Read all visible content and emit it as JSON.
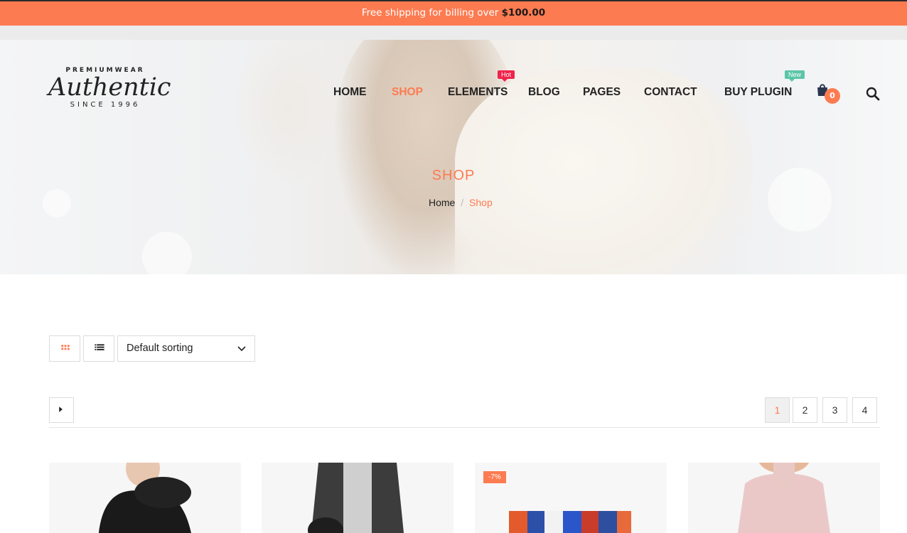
{
  "topbar": {
    "text": "Free shipping for billing over ",
    "amount": "$100.00"
  },
  "logo": {
    "top": "PREMIUMWEAR",
    "main": "Authentic",
    "since": "SINCE 1996"
  },
  "nav": {
    "items": [
      {
        "label": "HOME",
        "active": false
      },
      {
        "label": "SHOP",
        "active": true
      },
      {
        "label": "ELEMENTS",
        "active": false
      },
      {
        "label": "BLOG",
        "active": false
      },
      {
        "label": "PAGES",
        "active": false
      },
      {
        "label": "CONTACT",
        "active": false
      },
      {
        "label": "BUY PLUGIN",
        "active": false
      }
    ],
    "hot_tag": "Hot",
    "new_tag": "New",
    "cart_count": "0",
    "icons": {
      "cart": "cart-icon",
      "search": "search-icon"
    }
  },
  "hero": {
    "title": "SHOP",
    "breadcrumb": {
      "home": "Home",
      "separator": "/",
      "current": "Shop"
    }
  },
  "toolbar": {
    "view_grid": "grid-view-icon",
    "view_list": "list-view-icon",
    "sort": "Default sorting"
  },
  "pagination": {
    "pages": [
      "1",
      "2",
      "3",
      "4"
    ],
    "current": "1"
  },
  "products": [
    {
      "name": "",
      "badge": ""
    },
    {
      "name": "",
      "badge": ""
    },
    {
      "name": "",
      "badge": "-7%"
    },
    {
      "name": "",
      "badge": ""
    }
  ],
  "colors": {
    "accent": "#fd7b51",
    "hot": "#f0234b",
    "new": "#5bc5a7"
  }
}
